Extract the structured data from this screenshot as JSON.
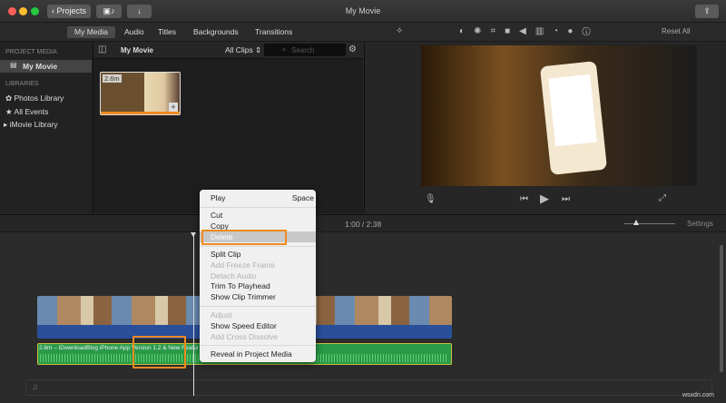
{
  "window": {
    "title": "My Movie",
    "projects_button": "Projects"
  },
  "tabs": [
    "My Media",
    "Audio",
    "Titles",
    "Backgrounds",
    "Transitions"
  ],
  "sidebar": {
    "project_media_header": "PROJECT MEDIA",
    "project": "My Movie",
    "libraries_header": "LIBRARIES",
    "items": [
      "Photos Library",
      "All Events",
      "iMovie Library"
    ]
  },
  "browser": {
    "title": "My Movie",
    "filter": "All Clips ⇕",
    "search_placeholder": "Search",
    "clip_duration": "2.6m"
  },
  "viewer": {
    "reset_all": "Reset All"
  },
  "timeline": {
    "timecode": "1:00 / 2:38",
    "settings": "Settings",
    "audio_clip_label": "2.6m – iDownloadBlog iPhone App Version 1.2 & New Features"
  },
  "context_menu": {
    "items": [
      {
        "label": "Play",
        "shortcut": "Space",
        "enabled": true
      },
      {
        "label": "Cut",
        "enabled": true
      },
      {
        "label": "Copy",
        "enabled": true
      },
      {
        "label": "Delete",
        "enabled": true,
        "highlighted": true
      },
      {
        "label": "Split Clip",
        "enabled": true
      },
      {
        "label": "Add Freeze Frame",
        "enabled": false
      },
      {
        "label": "Detach Audio",
        "enabled": false
      },
      {
        "label": "Trim To Playhead",
        "enabled": true
      },
      {
        "label": "Show Clip Trimmer",
        "enabled": true
      },
      {
        "label": "Adjust",
        "enabled": false
      },
      {
        "label": "Show Speed Editor",
        "enabled": true
      },
      {
        "label": "Add Cross Dissolve",
        "enabled": false
      },
      {
        "label": "Reveal in Project Media",
        "enabled": true
      }
    ]
  },
  "watermark": "wsxdn.com",
  "colors": {
    "highlight": "#f08a20",
    "video_clip": "#2a4f9a",
    "audio_clip": "#2a9a48"
  }
}
